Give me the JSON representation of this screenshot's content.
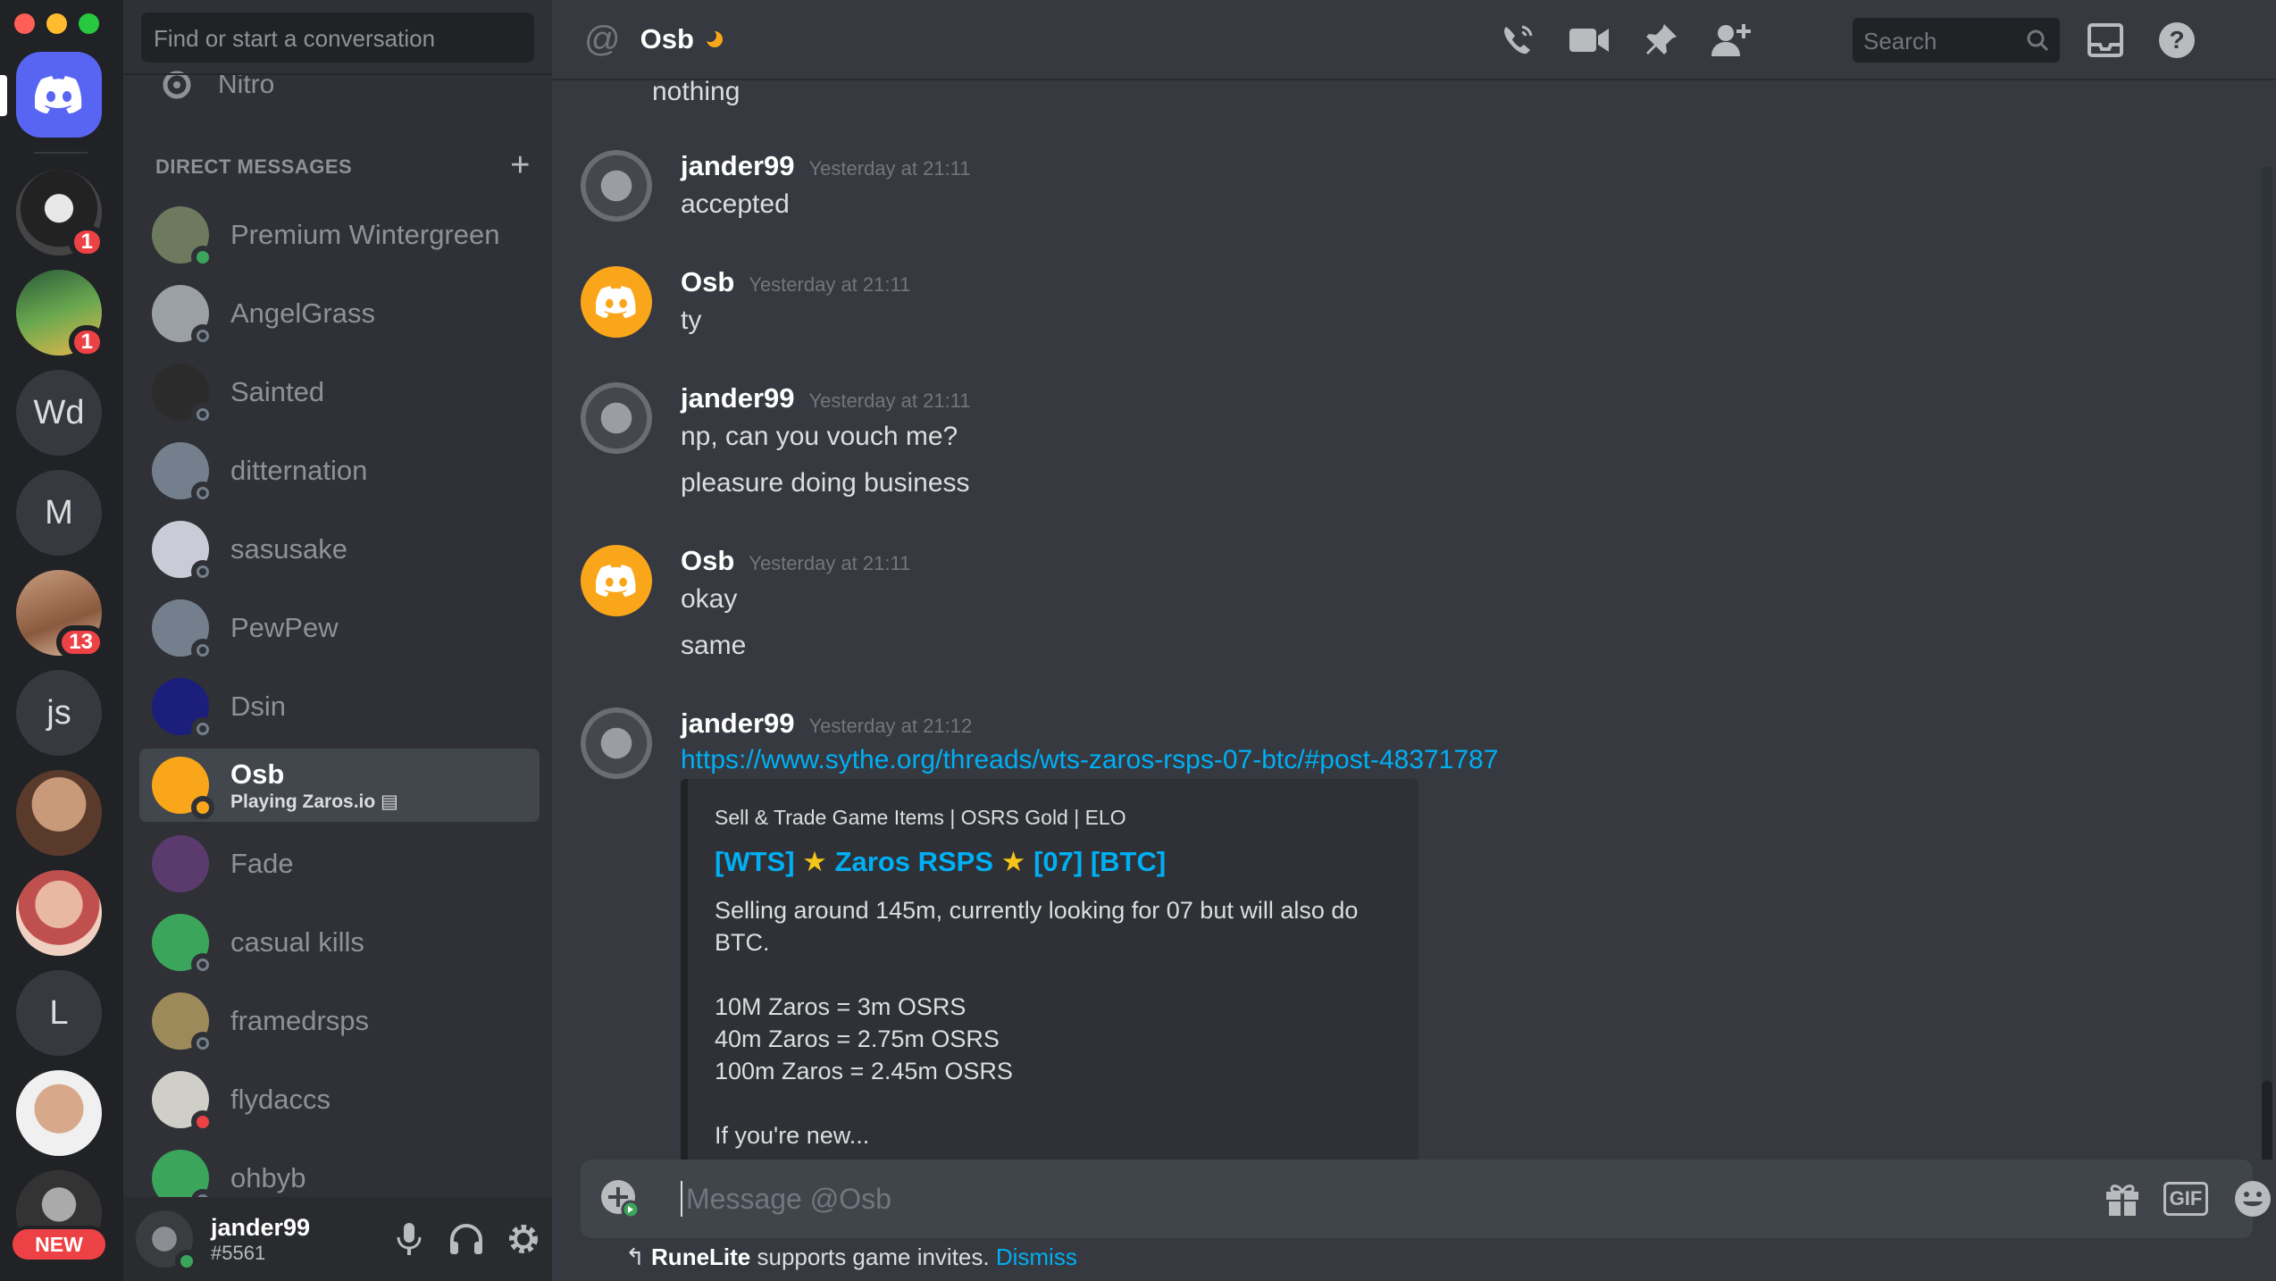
{
  "servers": {
    "items": [
      {
        "name": "home",
        "label": ""
      },
      {
        "name": "server-skull",
        "label": "",
        "badge": "1"
      },
      {
        "name": "server-runefort",
        "label": "",
        "badge": "1"
      },
      {
        "name": "server-wd",
        "label": "Wd"
      },
      {
        "name": "server-m",
        "label": "M"
      },
      {
        "name": "server-photo",
        "label": "",
        "badge": "13"
      },
      {
        "name": "server-js",
        "label": "js"
      },
      {
        "name": "server-face",
        "label": ""
      },
      {
        "name": "server-girl",
        "label": ""
      },
      {
        "name": "server-l",
        "label": "L"
      },
      {
        "name": "server-man",
        "label": ""
      },
      {
        "name": "server-new",
        "label": "",
        "badge": "NEW"
      }
    ]
  },
  "sidebar": {
    "search_placeholder": "Find or start a conversation",
    "nitro_label": "Nitro",
    "dm_header": "DIRECT MESSAGES",
    "dms": [
      {
        "name": "Premium Wintergreen",
        "status": "online",
        "color": "#6d7a5e"
      },
      {
        "name": "AngelGrass",
        "status": "offline",
        "color": "#9aa0a6"
      },
      {
        "name": "Sainted",
        "status": "offline",
        "color": "#2b2b2b"
      },
      {
        "name": "ditternation",
        "status": "offline",
        "color": "#747f8d"
      },
      {
        "name": "sasusake",
        "status": "offline",
        "color": "#c9ccd6"
      },
      {
        "name": "PewPew",
        "status": "offline",
        "color": "#747f8d"
      },
      {
        "name": "Dsin",
        "status": "offline",
        "color": "#1b1e7a"
      },
      {
        "name": "Osb",
        "status": "idle",
        "color": "#faa61a",
        "sub": "Playing Zaros.io"
      },
      {
        "name": "Fade",
        "status": "none",
        "color": "#5b3a6d"
      },
      {
        "name": "casual kills",
        "status": "offline",
        "color": "#3ba55c"
      },
      {
        "name": "framedrsps",
        "status": "offline",
        "color": "#9c8a5a"
      },
      {
        "name": "flydaccs",
        "status": "dnd",
        "color": "#d0cfc7"
      },
      {
        "name": "ohbyb",
        "status": "offline",
        "color": "#3ba55c"
      }
    ]
  },
  "user": {
    "name": "jander99",
    "tag": "#5561"
  },
  "header": {
    "title": "Osb",
    "search_placeholder": "Search"
  },
  "messages": {
    "top_fragment": "nothing",
    "groups": [
      {
        "author": "jander99",
        "time": "Yesterday at 21:11",
        "lines": [
          "accepted"
        ]
      },
      {
        "author": "Osb",
        "time": "Yesterday at 21:11",
        "lines": [
          "ty"
        ]
      },
      {
        "author": "jander99",
        "time": "Yesterday at 21:11",
        "lines": [
          "np, can you vouch me?",
          "pleasure doing business"
        ]
      },
      {
        "author": "Osb",
        "time": "Yesterday at 21:11",
        "lines": [
          "okay",
          "same"
        ]
      },
      {
        "author": "jander99",
        "time": "Yesterday at 21:12",
        "lines": [
          "https://www.sythe.org/threads/wts-zaros-rsps-07-btc/#post-48371787"
        ]
      }
    ],
    "embed": {
      "provider": "Sell & Trade Game Items | OSRS Gold | ELO",
      "title_part1": "[WTS]",
      "title_part2": "Zaros RSPS",
      "title_part3": "[07] [BTC]",
      "desc": [
        "Selling around 145m, currently looking for 07 but will also do BTC.",
        "",
        "10M Zaros = 3m OSRS",
        "40m Zaros = 2.75m OSRS",
        "100m Zaros = 2.45m OSRS",
        "",
        "If you're new..."
      ]
    }
  },
  "composer": {
    "placeholder": "Message @Osb",
    "gif_label": "GIF"
  },
  "invite_bar": {
    "app": "RuneLite",
    "text": " supports game invites. ",
    "dismiss": "Dismiss"
  },
  "colors": {
    "blurple": "#5865f2",
    "link": "#00aff4",
    "online": "#3ba55c",
    "idle": "#faa81a",
    "dnd": "#ed4245"
  }
}
